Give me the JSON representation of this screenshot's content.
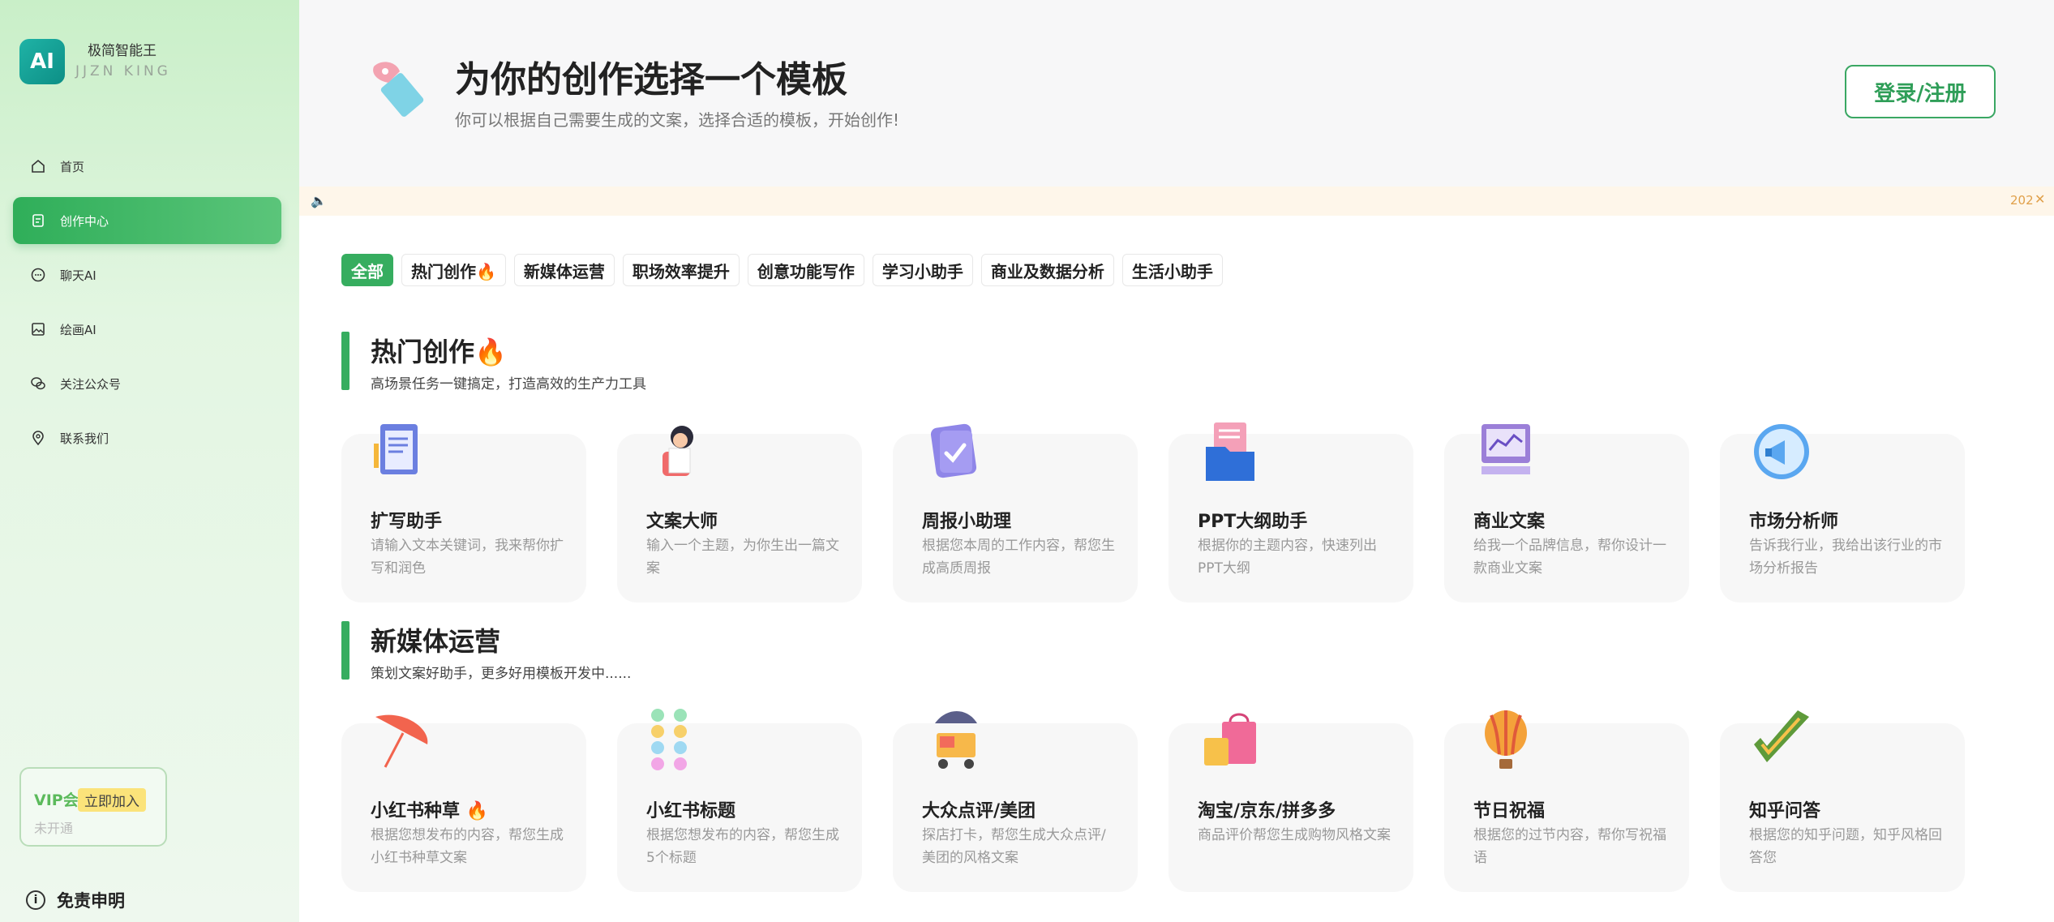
{
  "brand": {
    "logo_text": "AI",
    "name": "极简智能王",
    "sub": "JJZN KING"
  },
  "nav": [
    {
      "label": "首页",
      "icon": "home-icon"
    },
    {
      "label": "创作中心",
      "icon": "document-icon"
    },
    {
      "label": "聊天AI",
      "icon": "chat-icon"
    },
    {
      "label": "绘画AI",
      "icon": "image-icon"
    },
    {
      "label": "关注公众号",
      "icon": "wechat-icon"
    },
    {
      "label": "联系我们",
      "icon": "location-icon"
    }
  ],
  "vip": {
    "title": "VIP会",
    "button": "立即加入",
    "status": "未开通"
  },
  "disclaimer": {
    "label": "免责申明",
    "icon_glyph": "i"
  },
  "header": {
    "title": "为你的创作选择一个模板",
    "subtitle": "你可以根据自己需要生成的文案，选择合适的模板，开始创作!",
    "login": "登录/注册"
  },
  "notice": {
    "text": "202",
    "close": "✕",
    "speaker": "🔈"
  },
  "tabs": [
    "全部",
    "热门创作🔥",
    "新媒体运营",
    "职场效率提升",
    "创意功能写作",
    "学习小助手",
    "商业及数据分析",
    "生活小助手"
  ],
  "sections": [
    {
      "title": "热门创作🔥",
      "subtitle": "高场景任务一键搞定，打造高效的生产力工具",
      "cards": [
        {
          "name": "扩写助手",
          "desc": "请输入文本关键词，我来帮你扩写和润色",
          "icon": "writing-pad-icon"
        },
        {
          "name": "文案大师",
          "desc": "输入一个主题，为你生出一篇文案",
          "icon": "writer-girl-icon"
        },
        {
          "name": "周报小助理",
          "desc": "根据您本周的工作内容，帮您生成高质周报",
          "icon": "report-check-icon"
        },
        {
          "name": "PPT大纲助手",
          "desc": "根据你的主题内容，快速列出PPT大纲",
          "icon": "folder-icon"
        },
        {
          "name": "商业文案",
          "desc": "给我一个品牌信息，帮你设计一款商业文案",
          "icon": "chart-board-icon"
        },
        {
          "name": "市场分析师",
          "desc": "告诉我行业，我给出该行业的市场分析报告",
          "icon": "megaphone-icon"
        }
      ]
    },
    {
      "title": "新媒体运营",
      "subtitle": "策划文案好助手，更多好用模板开发中......",
      "cards": [
        {
          "name": "小红书种草 🔥",
          "desc": "根据您想发布的内容，帮您生成小红书种草文案",
          "icon": "umbrella-icon"
        },
        {
          "name": "小红书标题",
          "desc": "根据您想发布的内容，帮您生成5个标题",
          "icon": "dots-icon"
        },
        {
          "name": "大众点评/美团",
          "desc": "探店打卡，帮您生成大众点评/美团的风格文案",
          "icon": "food-cart-icon"
        },
        {
          "name": "淘宝/京东/拼多多",
          "desc": "商品评价帮您生成购物风格文案",
          "icon": "shopping-bag-icon"
        },
        {
          "name": "节日祝福",
          "desc": "根据您的过节内容，帮你写祝福语",
          "icon": "balloon-icon"
        },
        {
          "name": "知乎问答",
          "desc": "根据您的知乎问题，知乎风格回答您",
          "icon": "check-card-icon"
        }
      ]
    }
  ]
}
